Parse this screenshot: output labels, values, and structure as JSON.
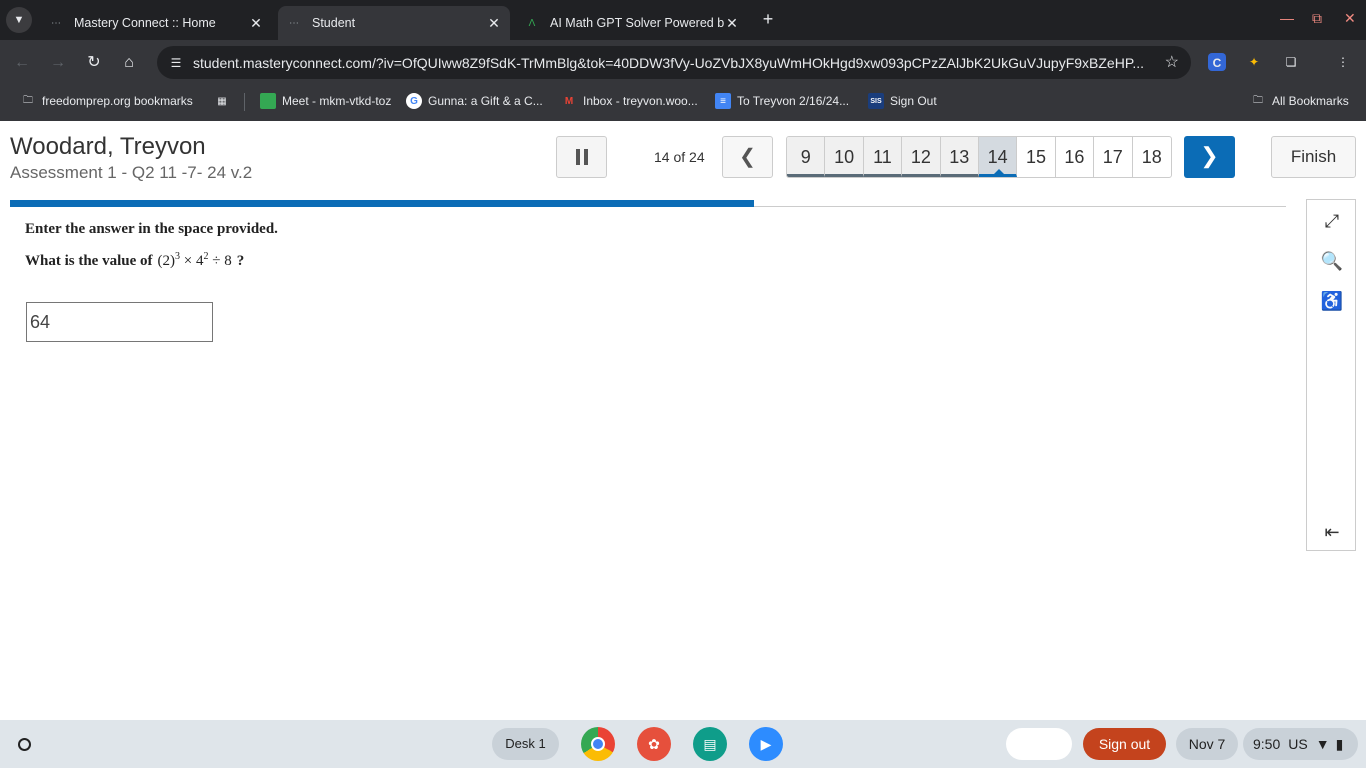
{
  "browser": {
    "tabs": [
      {
        "title": "Mastery Connect :: Home",
        "active": false
      },
      {
        "title": "Student",
        "active": true
      },
      {
        "title": "AI Math GPT Solver Powered by",
        "active": false
      }
    ],
    "url": "student.masteryconnect.com/?iv=OfQUIww8Z9fSdK-TrMmBlg&tok=40DDW3fVy-UoZVbJX8yuWmHOkHgd9xw093pCPzZAlJbK2UkGuVJupyF9xBZeHP...",
    "bookmarks": [
      {
        "label": "freedomprep.org bookmarks"
      },
      {
        "label": "Meet - mkm-vtkd-toz"
      },
      {
        "label": "Gunna: a Gift & a C..."
      },
      {
        "label": "Inbox - treyvon.woo..."
      },
      {
        "label": "To Treyvon 2/16/24..."
      },
      {
        "label": "Sign Out"
      }
    ],
    "all_bookmarks": "All Bookmarks",
    "ext_badge": "SIS"
  },
  "header": {
    "student_name": "Woodard, Treyvon",
    "assessment": "Assessment 1 - Q2 11 -7- 24 v.2",
    "counter": "14 of 24",
    "question_numbers": [
      "9",
      "10",
      "11",
      "12",
      "13",
      "14",
      "15",
      "16",
      "17",
      "18"
    ],
    "current_question": "14",
    "finish_label": "Finish",
    "progress": 0.583
  },
  "question": {
    "instructions": "Enter the answer in the space provided.",
    "prompt_prefix": "What is the value of",
    "math": {
      "base1": "(2)",
      "exp1": "3",
      "op1": "×",
      "base2": "4",
      "exp2": "2",
      "op2": "÷",
      "num": "8"
    },
    "prompt_suffix": "?",
    "answer_value": "64"
  },
  "shelf": {
    "desk": "Desk 1",
    "sign_out": "Sign out",
    "date": "Nov 7",
    "time": "9:50",
    "locale": "US"
  },
  "colors": {
    "accent": "#0b6cb6",
    "signout": "#c4431d"
  }
}
